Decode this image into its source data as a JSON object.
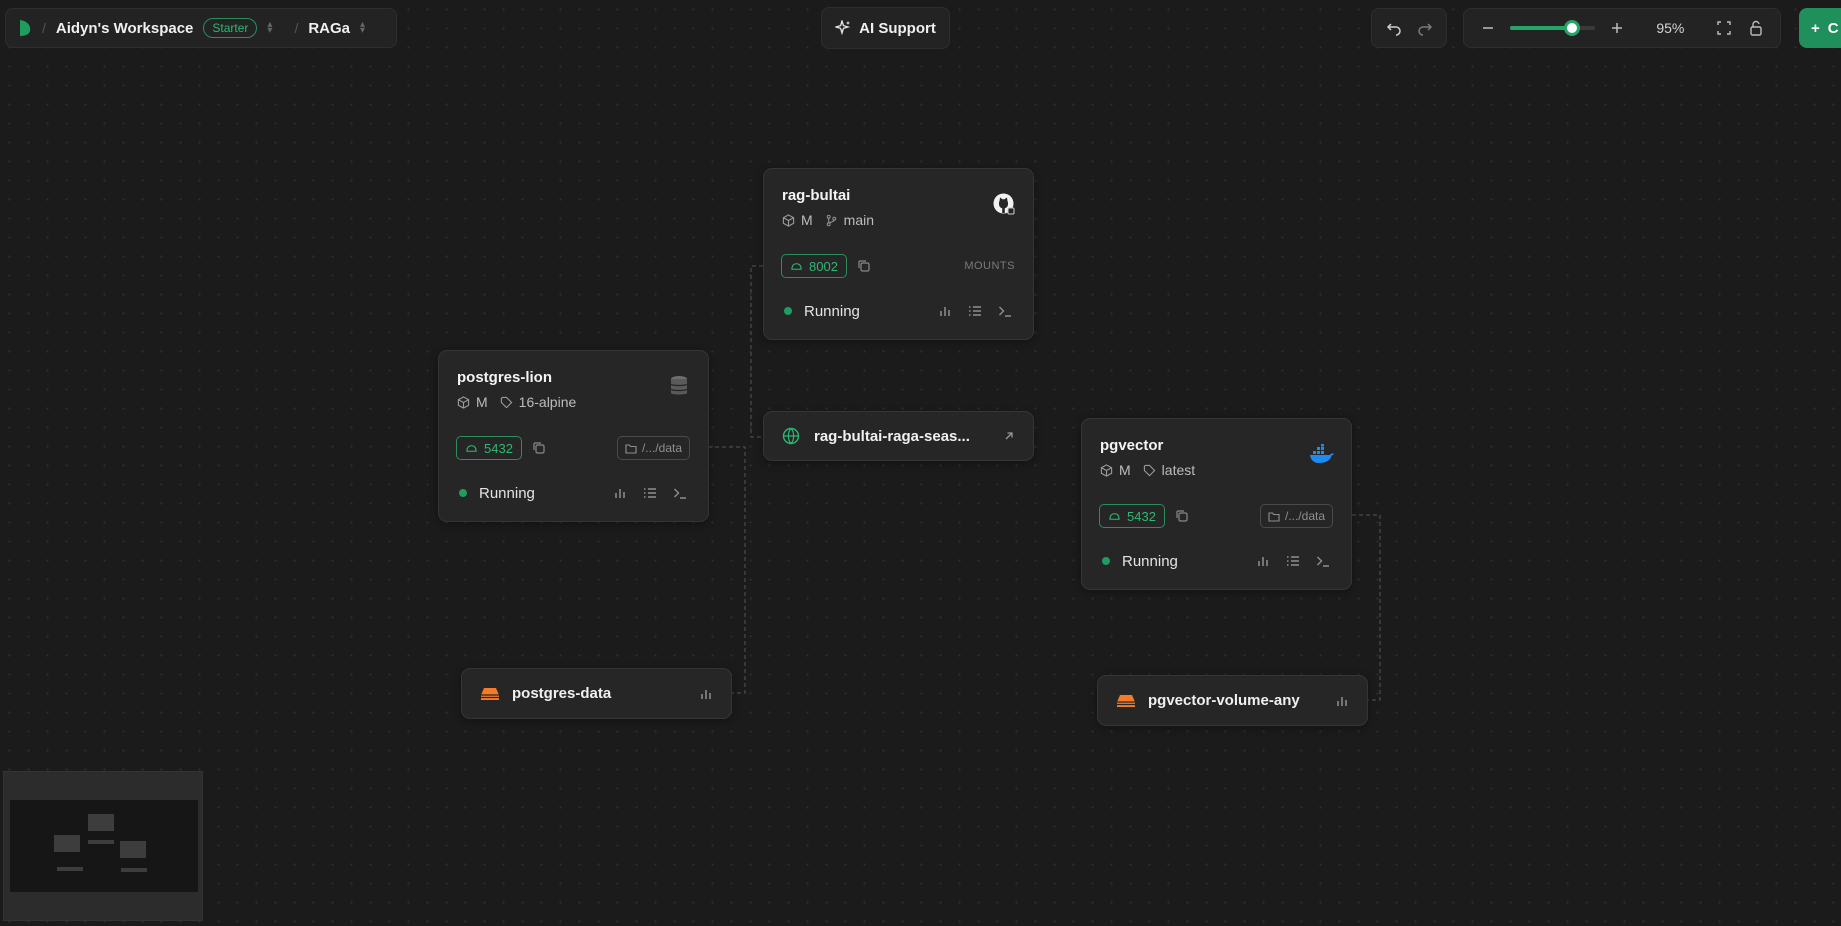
{
  "topbar": {
    "workspace_name": "Aidyn's Workspace",
    "plan_badge": "Starter",
    "project_name": "RAGa",
    "separator": "/",
    "logo_icon": "railway-leaf-logo",
    "ai_support_label": "AI Support",
    "zoom_level": "95%",
    "zoom_fraction": 0.62,
    "new_button_label": "C"
  },
  "colors": {
    "accent_green": "#1f9d5f",
    "volume_orange": "#f47b2a",
    "docker_blue": "#1d8bf1"
  },
  "services": [
    {
      "id": "rag-bultai",
      "title": "rag-bultai",
      "size": "M",
      "source_label": "main",
      "source_icon": "git-branch-icon",
      "type_icon": "github-icon",
      "port": "8002",
      "mounts_label": "MOUNTS",
      "status": "Running"
    },
    {
      "id": "postgres-lion",
      "title": "postgres-lion",
      "size": "M",
      "source_label": "16-alpine",
      "source_icon": "tag-icon",
      "type_icon": "database-icon",
      "port": "5432",
      "mount": "/.../data",
      "status": "Running"
    },
    {
      "id": "pgvector",
      "title": "pgvector",
      "size": "M",
      "source_label": "latest",
      "source_icon": "tag-icon",
      "type_icon": "docker-icon",
      "port": "5432",
      "mount": "/.../data",
      "status": "Running"
    }
  ],
  "domain": {
    "text": "rag-bultai-raga-seas..."
  },
  "volumes": [
    {
      "id": "postgres-data",
      "name": "postgres-data"
    },
    {
      "id": "pgvector-volume-any",
      "name": "pgvector-volume-any"
    }
  ]
}
